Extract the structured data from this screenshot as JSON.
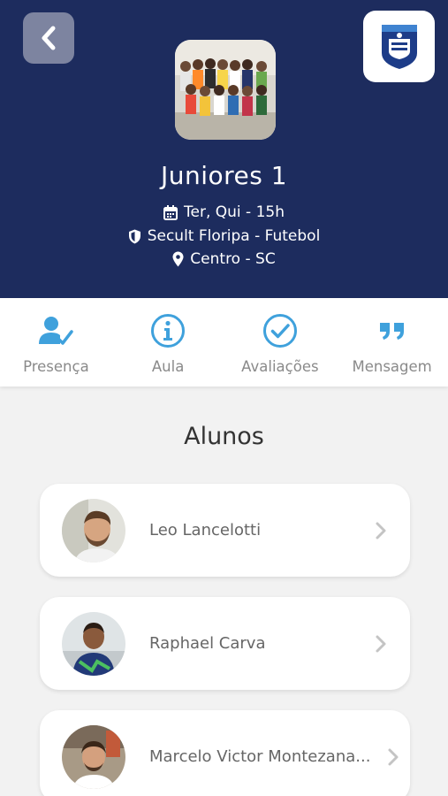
{
  "header": {
    "title": "Juniores 1",
    "schedule": "Ter, Qui - 15h",
    "program": "Secult Floripa - Futebol",
    "location": "Centro - SC"
  },
  "actions": [
    {
      "label": "Presença",
      "icon": "user-check-icon"
    },
    {
      "label": "Aula",
      "icon": "info-icon"
    },
    {
      "label": "Avaliações",
      "icon": "check-circle-icon"
    },
    {
      "label": "Mensagem",
      "icon": "quote-icon"
    }
  ],
  "students": {
    "title": "Alunos",
    "items": [
      {
        "name": "Leo Lancelotti"
      },
      {
        "name": "Raphael Carva"
      },
      {
        "name": "Marcelo Victor Montezana..."
      }
    ]
  },
  "colors": {
    "header_bg": "#1d2c5e",
    "accent": "#3fa1dc"
  }
}
